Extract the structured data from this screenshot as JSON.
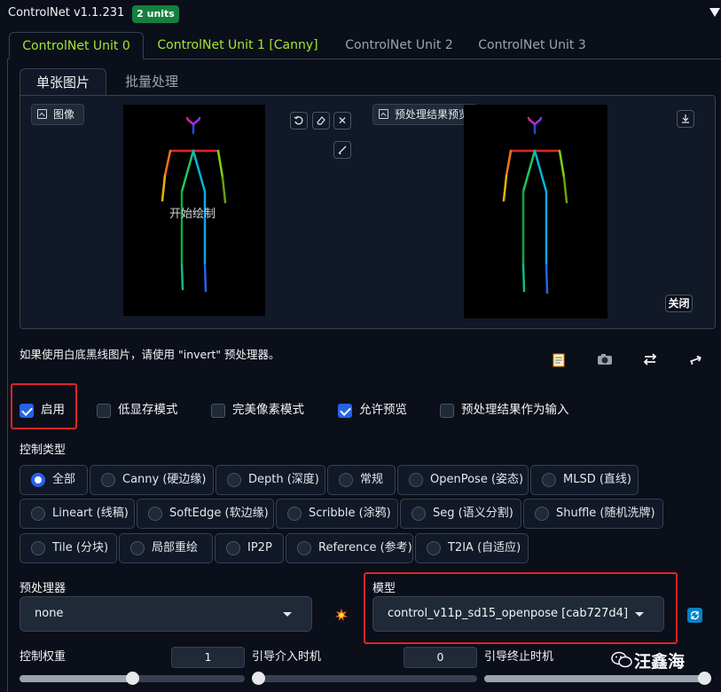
{
  "header": {
    "title": "ControlNet v1.1.231",
    "badge": "2 units",
    "collapse_icon": "triangle-down-icon"
  },
  "unit_tabs": [
    {
      "label": "ControlNet Unit 0",
      "active": true
    },
    {
      "label": "ControlNet Unit 1 [Canny]",
      "active": false
    },
    {
      "label": "ControlNet Unit 2",
      "active": false
    },
    {
      "label": "ControlNet Unit 3",
      "active": false
    }
  ],
  "sub_tabs": [
    {
      "label": "单张图片",
      "active": true
    },
    {
      "label": "批量处理",
      "active": false
    }
  ],
  "image_panel": {
    "input_label": "图像",
    "canvas_hint": "开始绘制",
    "preview_label": "预处理结果预览",
    "close_label": "关闭",
    "tools": [
      "undo-icon",
      "eraser-icon",
      "close-icon",
      "brush-icon"
    ],
    "download_icon": "download-icon"
  },
  "hint_text": "如果使用白底黑线图片，请使用 \"invert\" 预处理器。",
  "toolbar_icons": [
    "memo-icon",
    "camera-icon",
    "swap-icon",
    "send-icon"
  ],
  "checkboxes": [
    {
      "label": "启用",
      "checked": true
    },
    {
      "label": "低显存模式",
      "checked": false
    },
    {
      "label": "完美像素模式",
      "checked": false
    },
    {
      "label": "允许预览",
      "checked": true
    },
    {
      "label": "预处理结果作为输入",
      "checked": false
    }
  ],
  "control_type": {
    "label": "控制类型",
    "options": [
      "全部",
      "Canny (硬边缘)",
      "Depth (深度)",
      "常规",
      "OpenPose (姿态)",
      "MLSD (直线)",
      "Lineart (线稿)",
      "SoftEdge (软边缘)",
      "Scribble (涂鸦)",
      "Seg (语义分割)",
      "Shuffle (随机洗牌)",
      "Tile (分块)",
      "局部重绘",
      "IP2P",
      "Reference (参考)",
      "T2IA (自适应)"
    ],
    "selected": "全部"
  },
  "preprocessor": {
    "label": "预处理器",
    "value": "none",
    "run_icon": "explosion-icon"
  },
  "model": {
    "label": "模型",
    "value": "control_v11p_sd15_openpose [cab727d4]",
    "refresh_icon": "refresh-icon"
  },
  "sliders": {
    "weight": {
      "label": "控制权重",
      "value": "1",
      "fraction": 0.5
    },
    "start": {
      "label": "引导介入时机",
      "value": "0",
      "fraction": 0.0
    },
    "end": {
      "label": "引导终止时机",
      "fraction": 1.0
    }
  },
  "watermark": {
    "text": "汪鑫海",
    "icon": "wechat-icon"
  },
  "colors": {
    "accent": "#2563eb",
    "tab_active": "#a3e635",
    "highlight": "#dc2626",
    "bg": "#0b0f19"
  }
}
